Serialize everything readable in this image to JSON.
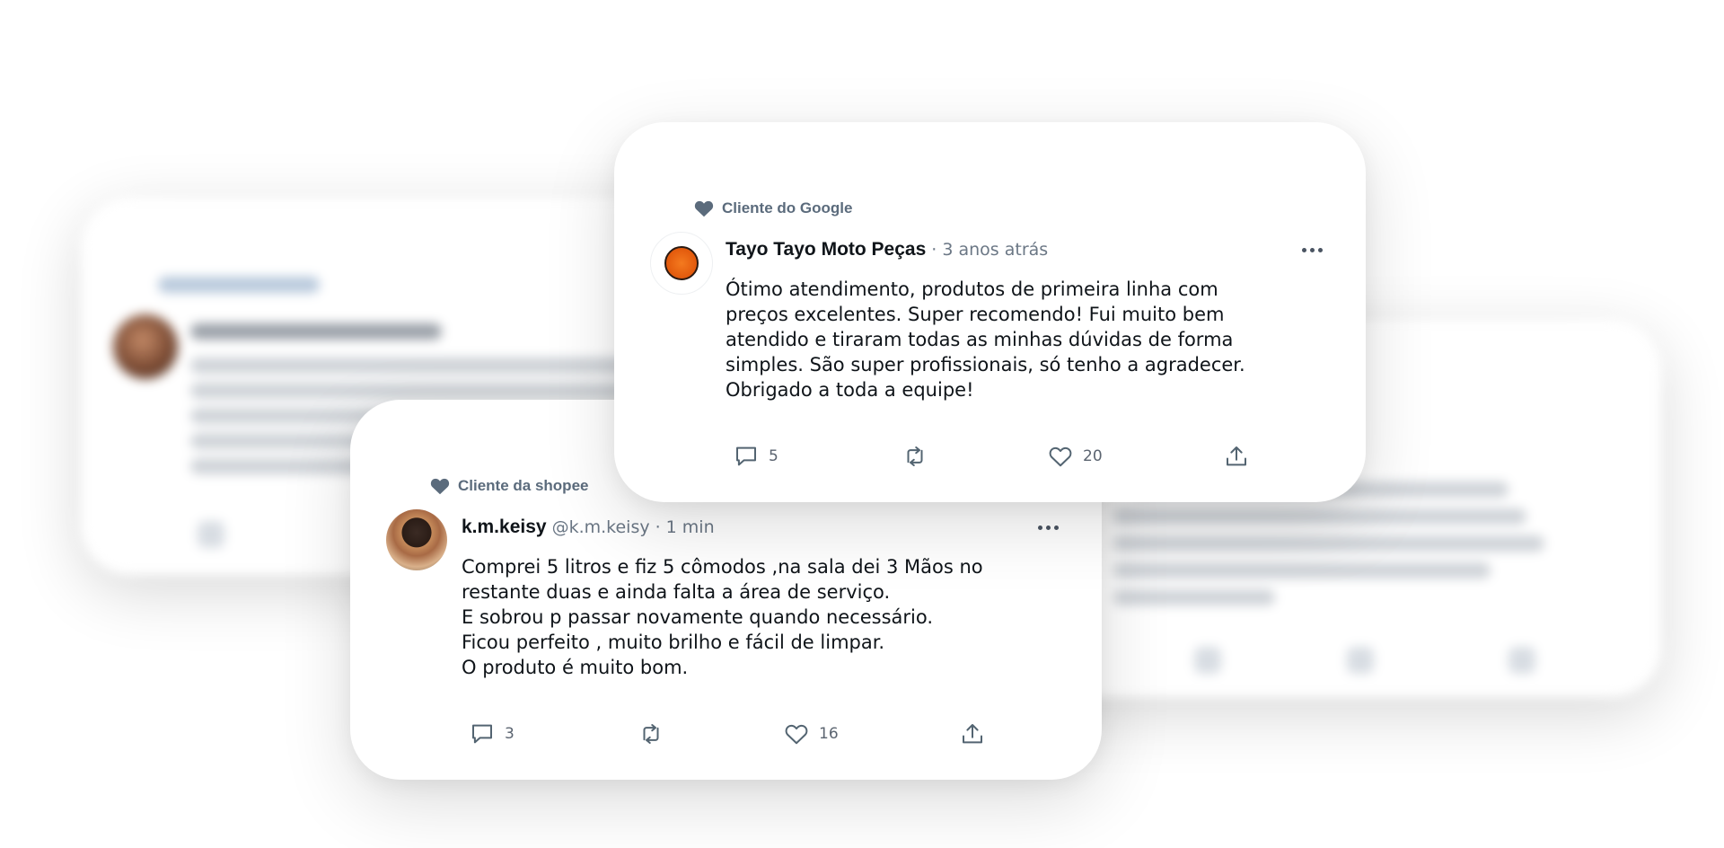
{
  "cards": [
    {
      "id": "google",
      "source_label": "Cliente do Google",
      "author": "Tayo Tayo Moto Peças",
      "handle": "",
      "time": "· 3 anos atrás",
      "text": "Ótimo atendimento, produtos de primeira linha com\npreços excelentes. Super recomendo! Fui muito bem\natendido e tiraram todas as minhas dúvidas de forma\nsimples. São super profissionais, só tenho a agradecer.\nObrigado a toda a equipe!",
      "reply_count": "5",
      "like_count": "20",
      "avatar_icon": "orange-logo-avatar"
    },
    {
      "id": "shopee",
      "source_label": "Cliente da shopee",
      "author": "k.m.keisy",
      "handle": "@k.m.keisy",
      "time": "1 min",
      "text": "Comprei 5 litros e fiz 5 cômodos ,na sala dei 3 Mãos no\nrestante duas e ainda falta a área de serviço.\nE sobrou p passar novamente quando necessário.\nFicou perfeito , muito brilho e fácil de limpar.\nO produto é muito bom.",
      "reply_count": "3",
      "like_count": "16",
      "avatar_icon": "user-photo-avatar"
    }
  ],
  "icons": {
    "source": "heart-icon",
    "reply": "comment-icon",
    "retweet": "retweet-icon",
    "like": "heart-outline-icon",
    "share": "share-icon",
    "more": "more-options-icon"
  },
  "colors": {
    "source_label": "#5b6b7c",
    "text": "#0f1419",
    "muted": "#6b7785",
    "icon": "#536471"
  }
}
